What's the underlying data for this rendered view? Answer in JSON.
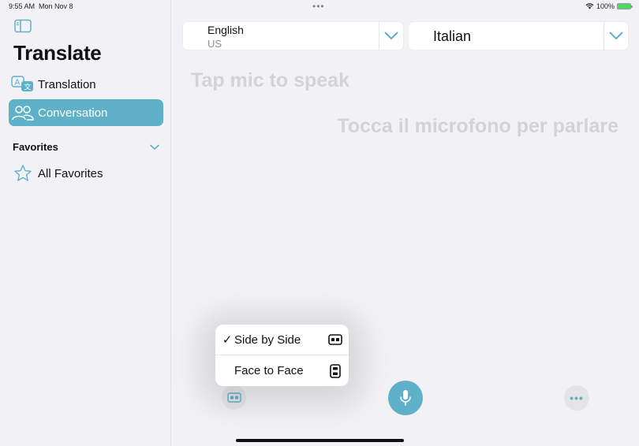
{
  "status": {
    "time": "9:55 AM",
    "date": "Mon Nov 8",
    "battery": "100%",
    "dots": "•••"
  },
  "sidebar": {
    "title": "Translate",
    "items": [
      {
        "label": "Translation",
        "icon": "translate-icon"
      },
      {
        "label": "Conversation",
        "icon": "people-icon",
        "selected": true
      }
    ],
    "favorites_header": "Favorites",
    "favorites": [
      {
        "label": "All Favorites",
        "icon": "star-icon"
      }
    ]
  },
  "languages": {
    "source": {
      "name": "English",
      "region": "US"
    },
    "target": {
      "name": "Italian"
    }
  },
  "placeholders": {
    "source": "Tap mic to speak",
    "target": "Tocca il microfono per parlare"
  },
  "layout_menu": {
    "options": [
      {
        "label": "Side by Side",
        "checked": true,
        "check": "✓",
        "icon": "side-by-side-icon"
      },
      {
        "label": "Face to Face",
        "checked": false,
        "check": "",
        "icon": "face-to-face-icon"
      }
    ]
  },
  "toolbar": {
    "more_label": "•••"
  },
  "colors": {
    "accent": "#5fb0c9",
    "background": "#f2f2f6",
    "placeholder": "#d2d2d7"
  }
}
